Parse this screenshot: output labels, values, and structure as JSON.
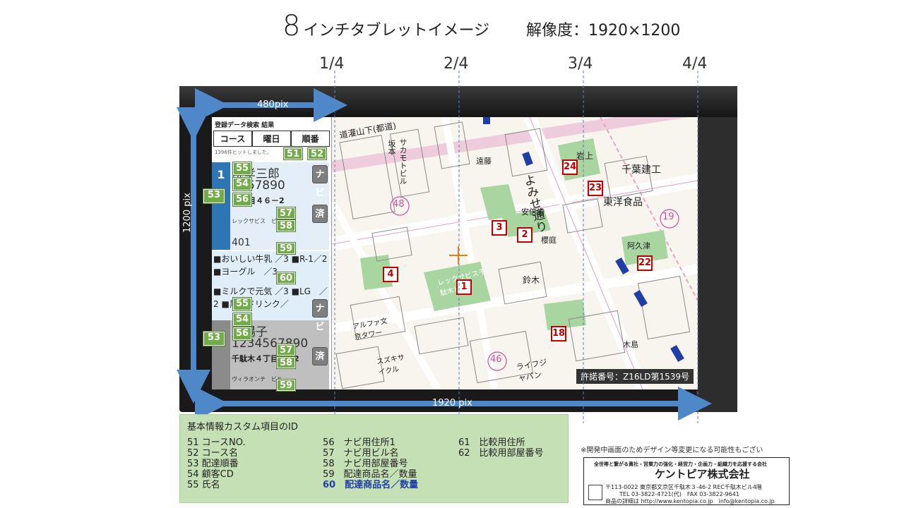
{
  "title": {
    "big": "8",
    "small": "インチタブレットイメージ",
    "resolution": "解像度：1920×1200"
  },
  "fractions": [
    "1/4",
    "2/4",
    "3/4",
    "4/4"
  ],
  "measures": {
    "width_480": "480pix",
    "width_1920": "1920 pix",
    "height_1200": "1200 pix"
  },
  "panel": {
    "header": "登録データ検索 結果",
    "tabs": [
      "コース",
      "曜日",
      "順番"
    ],
    "hits": "1396件ヒットしました。",
    "card1": {
      "number": "1",
      "name": "院孝三郎",
      "customer_no": "4567890",
      "address": ":3丁目４６－2",
      "building": "レックサビス　ビル",
      "room": "401",
      "navi": "ナビ",
      "done": "済"
    },
    "goods1": "■おいしい牛乳 ／3 ■R-1／2 ■ヨーグル　／3",
    "goods2": "■ミルクで元気 ／3 ■LG　／2 ■黒酢ドリンク／",
    "card2": {
      "name": "川陽子",
      "customer_no": "1234567890",
      "address": "千駄木４丁目　－2",
      "building": "ヴィラオンチ　ビル",
      "navi": "ナビ",
      "done": "済"
    },
    "tags": {
      "t51": "51",
      "t52": "52",
      "t53": "53",
      "t54": "54",
      "t55": "55",
      "t56": "56",
      "t57": "57",
      "t58": "58",
      "t59": "59",
      "t60": "60"
    }
  },
  "map": {
    "license": "許諾番号：Z16LD第1539号",
    "markers": [
      "24",
      "23",
      "3",
      "2",
      "4",
      "1",
      "22",
      "18"
    ],
    "labels": {
      "street": "よみせ通り",
      "bldg": "レックサビス千駄木ビル",
      "route48": "48",
      "route46": "46",
      "route19": "19",
      "c1": "東洋食品",
      "c2": "千葉建工",
      "c3": "岩上",
      "c4": "安倍歯",
      "c5": "鈴木",
      "c6": "櫻庭",
      "c7": "木島",
      "c8": "阿久津",
      "c9": "アルファ文京タワー",
      "c10": "スズキサイクル",
      "c11": "ライフジャパン",
      "c12": "遠藤",
      "c13": "道灌山下(都道)",
      "c14": "サカモトビル",
      "c15": "坂本"
    }
  },
  "legend": {
    "heading": "基本情報カスタム項目のID",
    "col1": [
      "51 コースNO.",
      "52 コース名",
      "53 配達順番",
      "54 顧客CD",
      "55 氏名"
    ],
    "col2": [
      "56　ナビ用住所1",
      "57　ナビ用ビル名",
      "58　ナビ用部屋番号",
      "59　配達商品名／数量",
      "60　配達商品名／数量"
    ],
    "col3": [
      "61　比較用住所",
      "62　比較用部屋番号"
    ]
  },
  "note": "※開発中画面のためデザイン等変更になる可能性もござい",
  "company": {
    "tagline": "全世帯と繋がる責社・営業力の強化・経営力・企画力・組織力を応援する会社",
    "name": "ケントピア株式会社",
    "address": "〒113-0022 東京都文京区千駄木３-46-2 REC千駄木ビル4階",
    "tel": "TEL 03-3822-4721(代)　FAX 03-3822-9641",
    "web": "商品の詳細は http://www.kentopia.co.jp　info@kentopia.co.jp"
  },
  "colors": {
    "accent_green": "#70ad47",
    "legend_bg": "#c5e0b4",
    "marker_red": "#c00000",
    "arrow_blue": "#2e75b6"
  }
}
